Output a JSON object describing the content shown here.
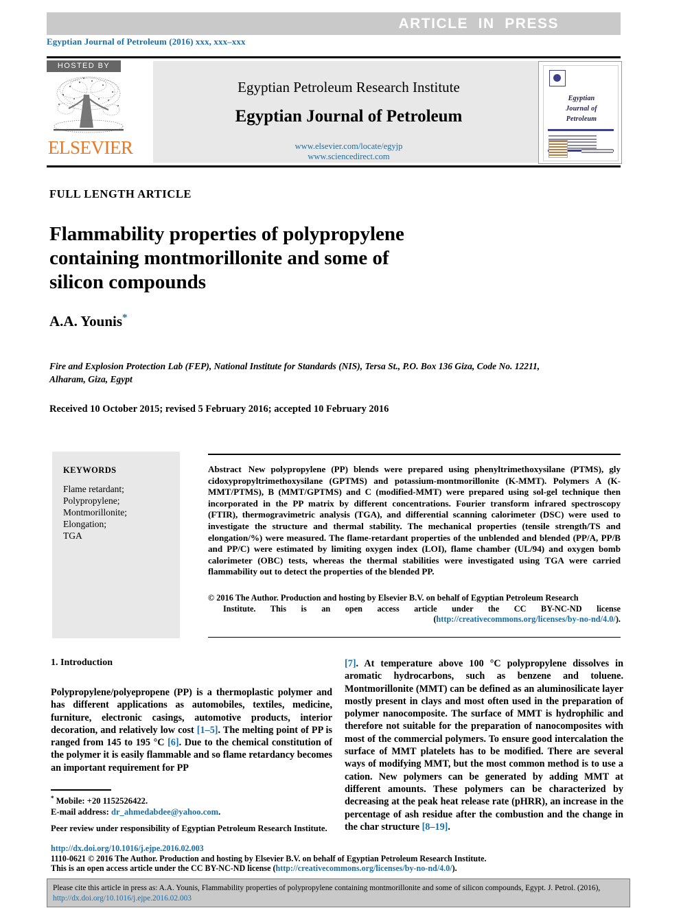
{
  "banner": {
    "text": "ARTICLE  IN  PRESS"
  },
  "journal_line": "Egyptian Journal of Petroleum (2016) xxx, xxx–xxx",
  "masthead": {
    "hosted_by": "HOSTED BY",
    "publisher": "ELSEVIER",
    "institute": "Egyptian Petroleum Research Institute",
    "journal": "Egyptian Journal of Petroleum",
    "link1": "www.elsevier.com/locate/egyjp",
    "link2": "www.sciencedirect.com",
    "cover": {
      "line1": "Egyptian",
      "line2": "Journal of",
      "line3": "Petroleum"
    }
  },
  "article": {
    "type": "FULL LENGTH ARTICLE",
    "title": "Flammability properties of polypropylene containing montmorillonite and some of silicon compounds",
    "author": "A.A. Younis",
    "author_marker": "*",
    "affiliation": "Fire and Explosion Protection Lab (FEP), National Institute for Standards (NIS), Tersa St., P.O. Box 136 Giza, Code No. 12211, Alharam, Giza, Egypt",
    "received": "Received 10 October 2015; revised 5 February 2016; accepted 10 February 2016"
  },
  "keywords": {
    "title": "KEYWORDS",
    "list": "Flame retardant;\nPolypropylene;\nMontmorillonite;\nElongation;\nTGA"
  },
  "abstract": {
    "label": "Abstract",
    "text": "New polypropylene (PP) blends were prepared using phenyltrimethoxysilane (PTMS), gly cidoxypropyltrimethoxysilane (GPTMS) and potassium-montmorillonite (K-MMT). Polymers A (K-MMT/PTMS), B (MMT/GPTMS) and C (modified-MMT) were prepared using sol-gel technique then incorporated in the PP matrix by different concentrations. Fourier transform infrared spectroscopy (FTIR), thermogravimetric analysis (TGA), and differential scanning calorimeter (DSC) were used to investigate the structure and thermal stability. The mechanical properties (tensile strength/TS and elongation/%) were measured. The flame-retardant properties of the unblended and blended (PP/A, PP/B and PP/C) were estimated by limiting oxygen index (LOI), flame chamber (UL/94) and oxygen bomb calorimeter (OBC) tests, whereas the thermal stabilities were investigated using TGA were carried flammability out to detect the properties of the blended PP.",
    "copyright_part1": "© 2016 The Author. Production and hosting by Elsevier B.V. on behalf of Egyptian Petroleum Research",
    "copyright_part2": "Institute.  This is an open access article under the CC BY-NC-ND license (",
    "copyright_link": "http://creativecommons.org/licenses/by-no-nd/4.0/",
    "copyright_part3": ")."
  },
  "introduction": {
    "heading": "1. Introduction",
    "p1_a": "Polypropylene/polyepropene (PP) is a thermoplastic polymer and has different applications as automobiles, textiles, medicine, furniture, electronic casings, automotive products, interior decoration, and relatively low cost ",
    "ref_1_5": "[1–5]",
    "p1_b": ". The melting point of PP is ranged from 145 to 195 °C ",
    "ref_6": "[6]",
    "p1_c": ". Due to the chemical constitution of the polymer it is easily flammable and so flame retardancy becomes an important requirement for PP",
    "r_ref_7": "[7]",
    "r_a": ". At temperature above 100 °C polypropylene dissolves in aromatic hydrocarbons, such as benzene and toluene. Montmorillonite (MMT) can be defined as an aluminosilicate layer mostly present in clays and most often used in the preparation of polymer nanocomposite. The surface of MMT is hydrophilic and therefore not suitable for the preparation of nanocomposites with most of the commercial polymers. To ensure good intercalation the surface of MMT platelets has to be modified. There are several ways of modifying MMT, but the most common method is to use a cation. New polymers can be generated by adding MMT at different amounts. These polymers can be characterized by decreasing at the peak heat release rate (pHRR), an increase in the percentage of ash residue after the combustion and the change in the char structure ",
    "r_ref_8_19": "[8–19]",
    "r_b": "."
  },
  "footnote": {
    "star": "*",
    "mobile": " Mobile: +20 1152526422.",
    "email_label": "E-mail address: ",
    "email": "dr_ahmedabdee@yahoo.com",
    "email_period": ".",
    "peer_review": "Peer review under responsibility of Egyptian Petroleum Research Institute."
  },
  "bottom_legal": {
    "doi": "http://dx.doi.org/10.1016/j.ejpe.2016.02.003",
    "line2": "1110-0621 © 2016 The Author. Production and hosting by Elsevier B.V. on behalf of Egyptian Petroleum Research Institute.",
    "line3_a": "This is an open access article under the CC BY-NC-ND license (",
    "line3_link": "http://creativecommons.org/licenses/by-no-nd/4.0/",
    "line3_b": ")."
  },
  "cite_box": {
    "text_a": "Please cite this article in press as: A.A. Younis, Flammability properties of polypropylene containing montmorillonite and some of silicon compounds,  Egypt. J. Petrol. (2016), ",
    "link": "http://dx.doi.org/10.1016/j.ejpe.2016.02.003"
  },
  "colors": {
    "link": "#1a6ea8",
    "elsevier_orange": "#E87722",
    "banner_gray": "#c9c9c9",
    "panel_gray": "#e8e8e8"
  }
}
